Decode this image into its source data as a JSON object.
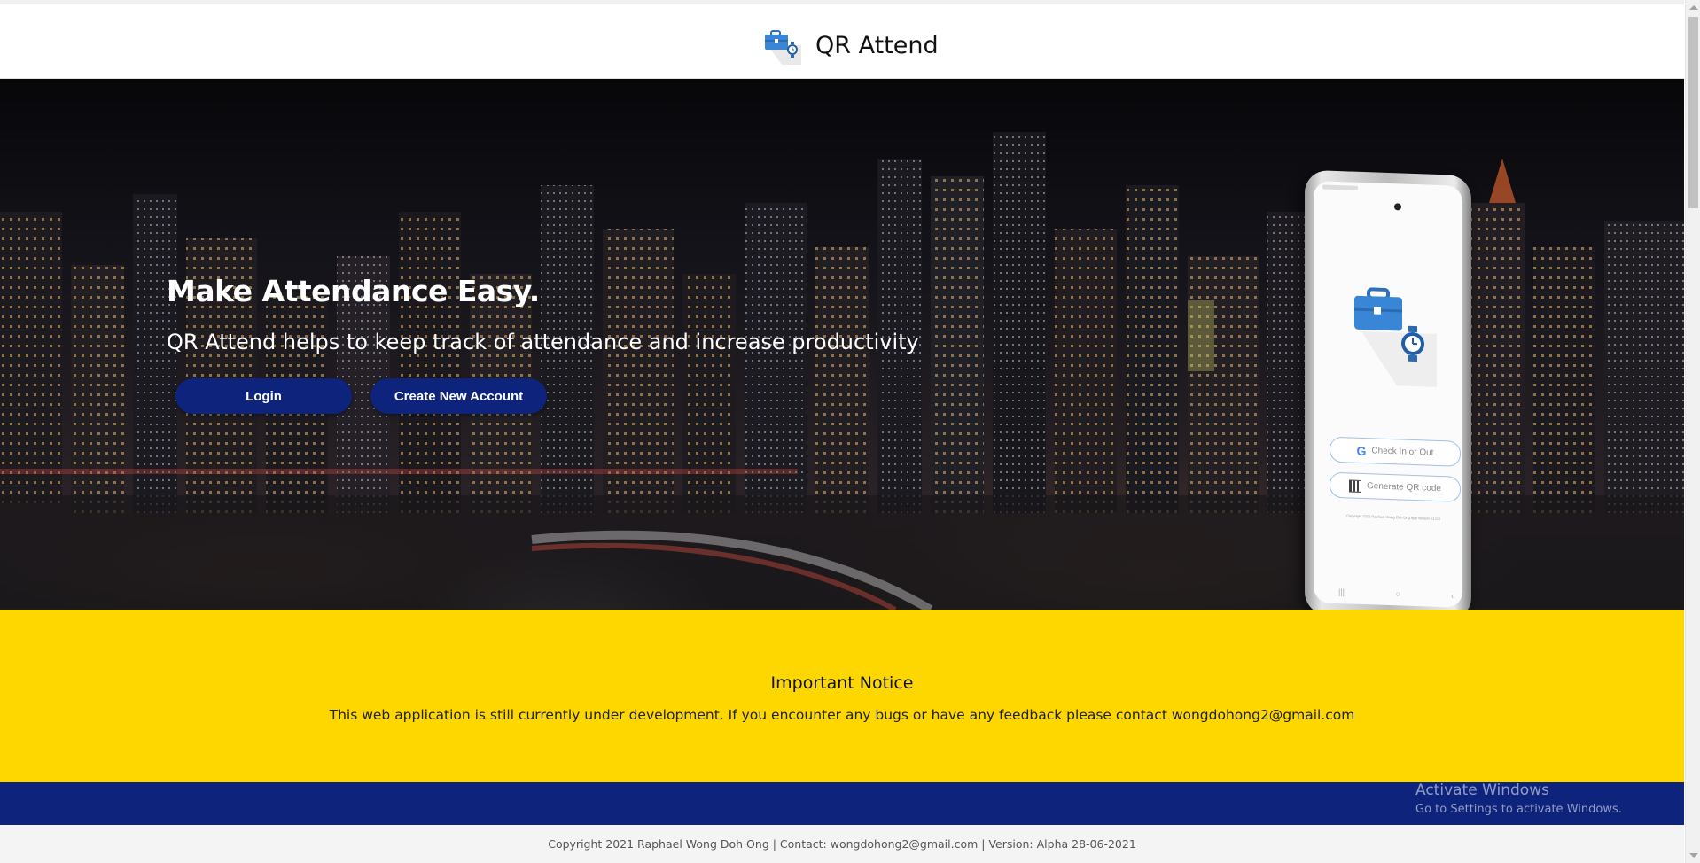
{
  "header": {
    "title": "QR Attend",
    "logo_icon": "briefcase-clock-icon"
  },
  "hero": {
    "heading": "Make Attendance Easy.",
    "subheading": "QR Attend helps to keep track of attendance and increase productivity",
    "login_label": "Login",
    "create_account_label": "Create New Account"
  },
  "phone": {
    "check_in_label": "Check In or Out",
    "generate_qr_label": "Generate QR code",
    "copyright": "Copyright 2021 Raphael Wong Doh Ong App version v1.0.0"
  },
  "notice": {
    "title": "Important Notice",
    "text": "This web application is still currently under development. If you encounter any bugs or have any feedback please contact wongdohong2@gmail.com"
  },
  "footer": {
    "text": "Copyright 2021 Raphael Wong Doh Ong | Contact: wongdohong2@gmail.com | Version: Alpha 28-06-2021"
  },
  "watermark": {
    "line1": "Activate Windows",
    "line2": "Go to Settings to activate Windows."
  },
  "colors": {
    "primary_blue": "#0d237c",
    "notice_yellow": "#ffd700"
  }
}
